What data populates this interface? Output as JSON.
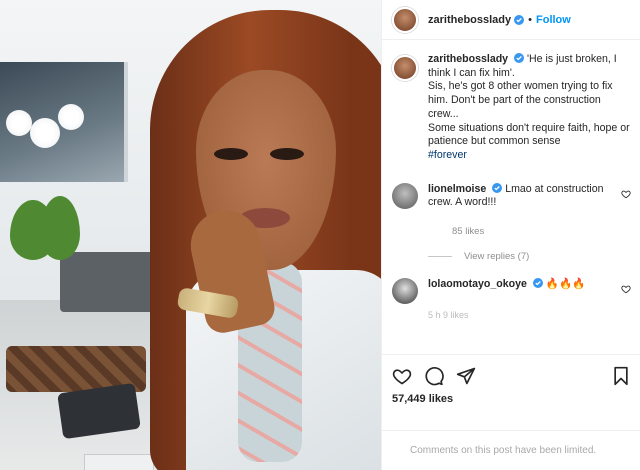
{
  "header": {
    "username": "zarithebosslady",
    "separator": "•",
    "follow_label": "Follow"
  },
  "caption": {
    "username": "zarithebosslady",
    "line1": "'He is just broken, I think I can fix him'.",
    "line2": "Sis, he's got 8 other women trying to fix him. Don't be part of the construction crew...",
    "line3": "Some situations don't require faith, hope or patience but common sense",
    "hashtag": "#forever"
  },
  "comments": [
    {
      "username": "lionelmoise",
      "text": "Lmao at construction crew. A word!!!",
      "likes": "85 likes",
      "view_replies": "View replies (7)"
    },
    {
      "username": "lolaomotayo_okoye",
      "text": "🔥🔥🔥",
      "faded": "5 h   9 likes"
    }
  ],
  "post": {
    "likes": "57,449 likes",
    "comments_limited": "Comments on this post have been limited."
  },
  "icons": {
    "like": "heart-icon",
    "comment": "comment-icon",
    "share": "share-icon",
    "save": "bookmark-icon",
    "verified": "verified-badge-icon"
  },
  "colors": {
    "accent": "#0095f6",
    "verified": "#3897f0",
    "muted": "#8e8e8e"
  }
}
